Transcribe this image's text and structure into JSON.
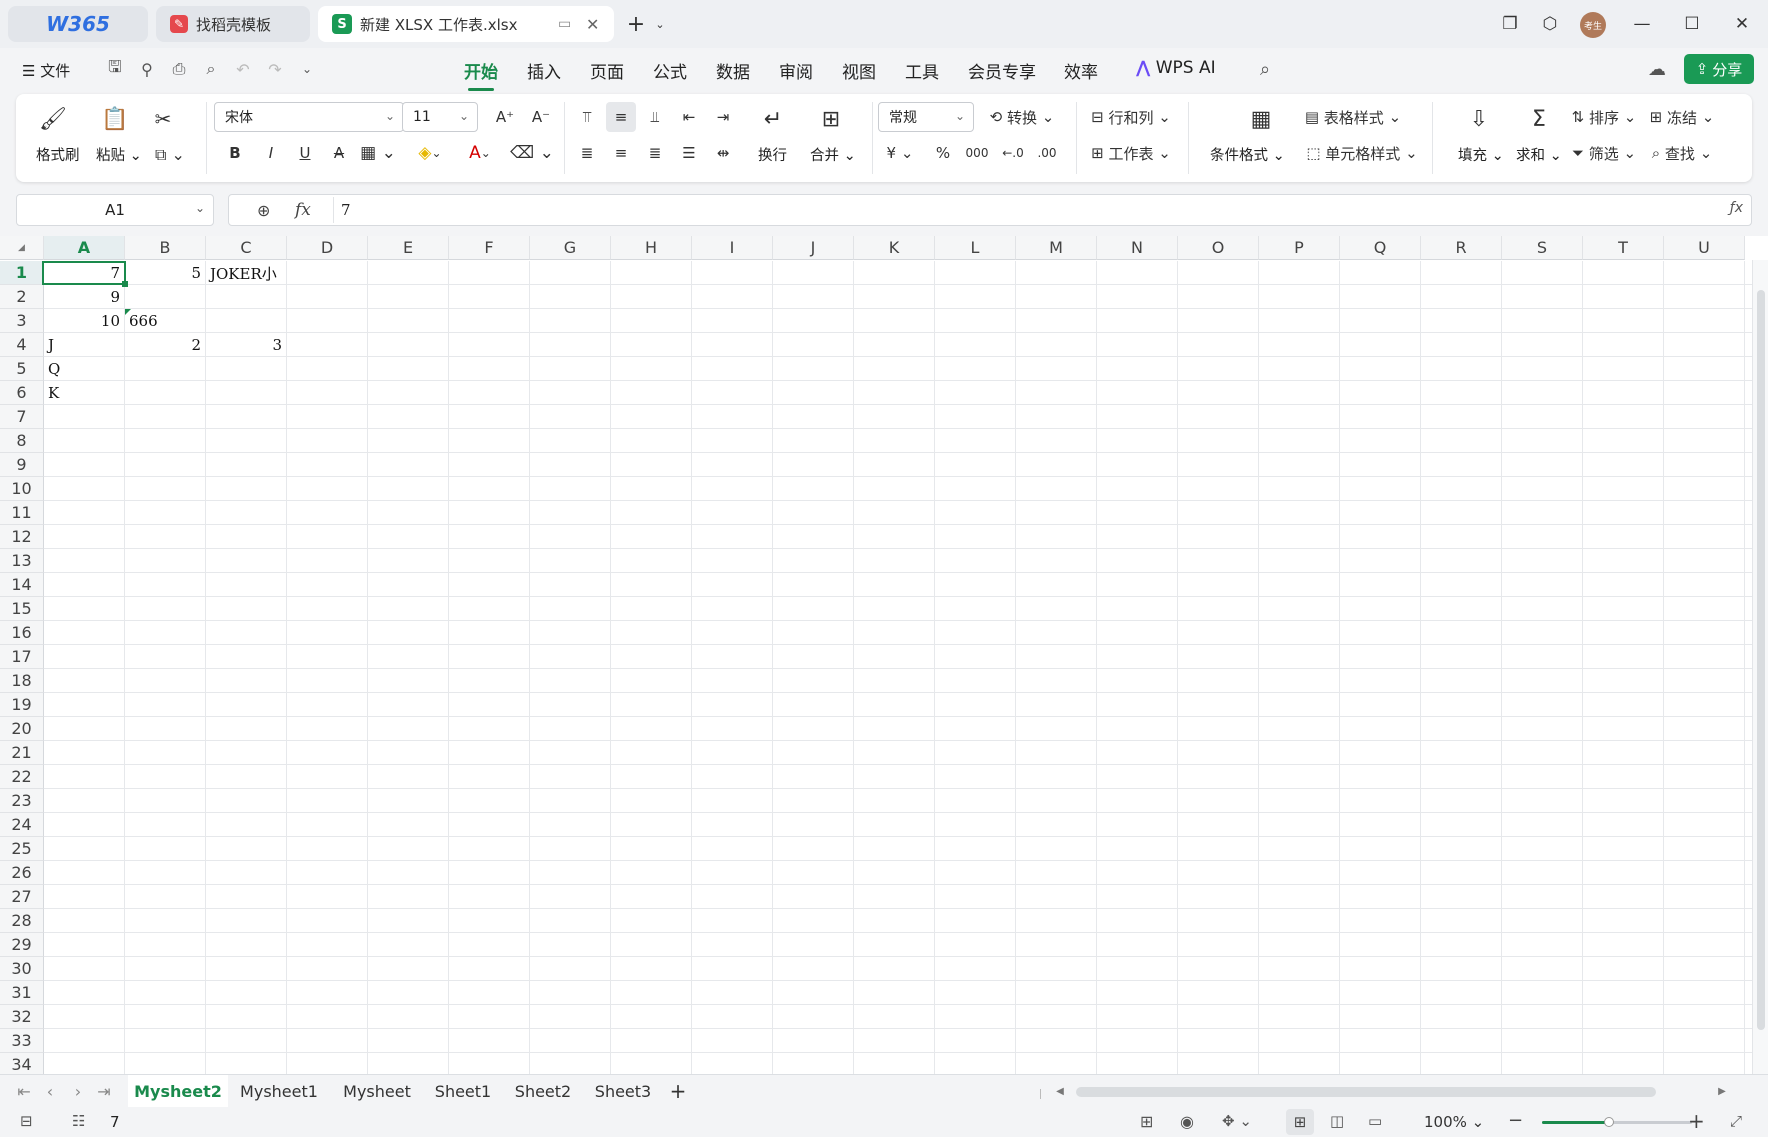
{
  "titlebar": {
    "w365": "W365",
    "tab_template": "找稻壳模板",
    "tab_active": "新建 XLSX 工作表.xlsx",
    "avatar_text": "考生"
  },
  "menubar": {
    "file": "文件",
    "tabs": [
      "开始",
      "插入",
      "页面",
      "公式",
      "数据",
      "审阅",
      "视图",
      "工具",
      "会员专享",
      "效率"
    ],
    "wps_ai": "WPS AI",
    "share": "分享"
  },
  "ribbon": {
    "format_painter": "格式刷",
    "paste": "粘贴",
    "font_name": "宋体",
    "font_size": "11",
    "bold": "B",
    "italic": "I",
    "underline": "U",
    "strike": "A",
    "wrap": "换行",
    "merge": "合并",
    "number_format": "常规",
    "convert": "转换",
    "percent": "%",
    "thousands": "000",
    "rows_cols": "行和列",
    "worksheet": "工作表",
    "cond_format": "条件格式",
    "table_style": "表格样式",
    "cell_style": "单元格样式",
    "fill": "填充",
    "sum": "求和",
    "sort": "排序",
    "filter": "筛选",
    "freeze": "冻结",
    "find": "查找"
  },
  "formula": {
    "cell_ref": "A1",
    "fx": "fx",
    "value": "7"
  },
  "grid": {
    "columns": [
      "A",
      "B",
      "C",
      "D",
      "E",
      "F",
      "G",
      "H",
      "I",
      "J",
      "K",
      "L",
      "M",
      "N",
      "O",
      "P",
      "Q",
      "R",
      "S",
      "T",
      "U"
    ],
    "rows": [
      "1",
      "2",
      "3",
      "4",
      "5",
      "6",
      "7",
      "8",
      "9",
      "10",
      "11",
      "12",
      "13",
      "14",
      "15",
      "16",
      "17",
      "18",
      "19",
      "20",
      "21",
      "22",
      "23",
      "24",
      "25",
      "26",
      "27",
      "28",
      "29",
      "30",
      "31",
      "32",
      "33",
      "34"
    ],
    "cells": {
      "A1": "7",
      "B1": "5",
      "C1": "JOKER小",
      "A2": "9",
      "A3": "10",
      "B3": "666",
      "A4": "J",
      "B4": "2",
      "C4": "3",
      "A5": "Q",
      "A6": "K"
    }
  },
  "sheets": [
    "Mysheet2",
    "Mysheet1",
    "Mysheet",
    "Sheet1",
    "Sheet2",
    "Sheet3"
  ],
  "status": {
    "value": "7",
    "zoom": "100%"
  },
  "colors": {
    "accent": "#1a8a4c",
    "selection": "#1a8a4c"
  }
}
